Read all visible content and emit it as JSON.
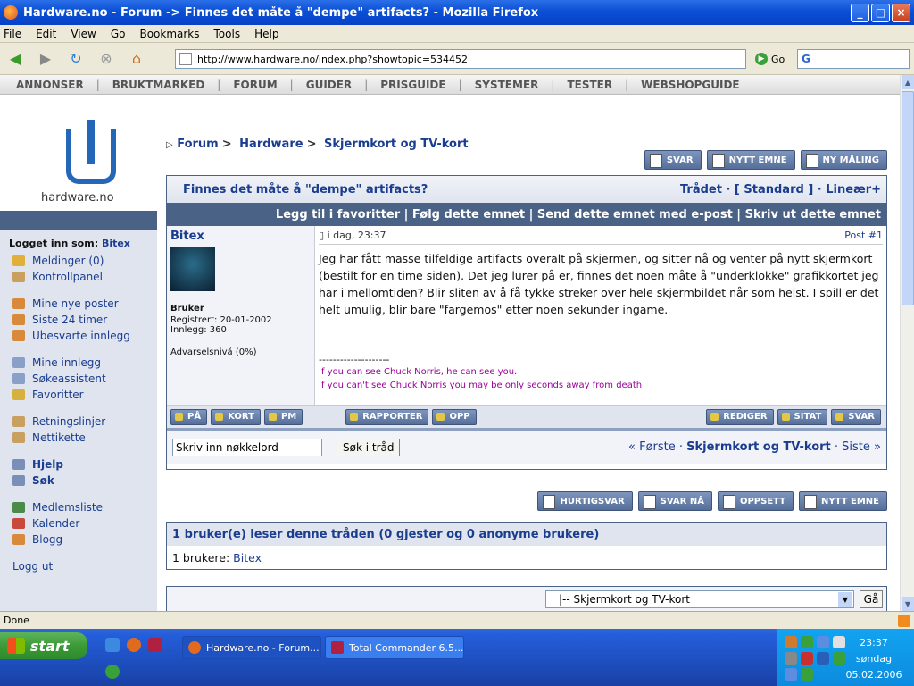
{
  "window": {
    "title": "Hardware.no - Forum -> Finnes det måte å \"dempe\" artifacts? - Mozilla Firefox"
  },
  "menu": [
    "File",
    "Edit",
    "View",
    "Go",
    "Bookmarks",
    "Tools",
    "Help"
  ],
  "navbar": {
    "url": "http://www.hardware.no/index.php?showtopic=534452",
    "go_label": "Go",
    "search_engine": "G"
  },
  "topnav": [
    "ANNONSER",
    "BRUKTMARKED",
    "FORUM",
    "GUIDER",
    "PRISGUIDE",
    "SYSTEMER",
    "TESTER",
    "WEBSHOPGUIDE"
  ],
  "logo": {
    "text": "hardware.no"
  },
  "sidebar": {
    "login_prefix": "Logget inn som:",
    "login_user": "Bitex",
    "group1": [
      "Meldinger (0)",
      "Kontrollpanel"
    ],
    "group2": [
      "Mine nye poster",
      "Siste 24 timer",
      "Ubesvarte innlegg"
    ],
    "group3": [
      "Mine innlegg",
      "Søkeassistent",
      "Favoritter"
    ],
    "group4": [
      "Retningslinjer",
      "Nettikette"
    ],
    "group5": [
      "Hjelp",
      "Søk"
    ],
    "group6": [
      "Medlemsliste",
      "Kalender",
      "Blogg"
    ],
    "logout": "Logg ut"
  },
  "breadcrumb": {
    "root": "Forum",
    "level1": "Hardware",
    "level2": "Skjermkort og TV-kort"
  },
  "topbuttons": [
    "SVAR",
    "NYTT EMNE",
    "NY MÅLING"
  ],
  "thread": {
    "title": "Finnes det måte å \"dempe\" artifacts?",
    "view_modes": "Trådet · [ Standard ] · Lineær+",
    "links": "Legg til i favoritter | Følg dette emnet | Send dette emnet med e-post | Skriv ut dette emnet"
  },
  "post": {
    "username": "Bitex",
    "role": "Bruker",
    "registered": "Registrert: 20-01-2002",
    "posts": "Innlegg: 360",
    "warning": "Advarselsnivå (0%)",
    "date": "i dag, 23:37",
    "number": "Post #1",
    "body": "Jeg har fått masse tilfeldige artifacts overalt på skjermen, og sitter nå og venter på nytt skjermkort (bestilt for en time siden). Det jeg lurer på er, finnes det noen måte å \"underklokke\" grafikkortet jeg har i mellomtiden? Blir sliten av å få tykke streker over hele skjermbildet når som helst. I spill er det helt umulig, blir bare \"fargemos\" etter noen sekunder ingame.",
    "sig_divider": "--------------------",
    "sig_line1": "If you can see Chuck Norris, he can see you.",
    "sig_line2": "If you can't see Chuck Norris you may be only seconds away from death",
    "left_buttons": [
      "PÅ",
      "KORT",
      "PM"
    ],
    "mid_buttons": [
      "RAPPORTER",
      "OPP"
    ],
    "right_buttons": [
      "REDIGER",
      "SITAT",
      "SVAR"
    ]
  },
  "thread_search": {
    "placeholder": "Skriv inn nøkkelord",
    "button": "Søk i tråd"
  },
  "pagenav": {
    "first": "« Første",
    "middle": "Skjermkort og TV-kort",
    "last": "Siste »"
  },
  "bottombuttons": [
    "HURTIGSVAR",
    "SVAR NÅ",
    "OPPSETT",
    "NYTT EMNE"
  ],
  "readers": {
    "title": "1 bruker(e) leser denne tråden (0 gjester og 0 anonyme brukere)",
    "line_prefix": "1 brukere:",
    "line_user": "Bitex"
  },
  "jump": {
    "selected": "|-- Skjermkort og TV-kort",
    "go": "Gå"
  },
  "statusbar": {
    "text": "Done"
  },
  "taskbar": {
    "start": "start",
    "tasks": [
      "Hardware.no - Forum...",
      "Total Commander 6.5..."
    ],
    "time": "23:37",
    "day": "søndag",
    "date": "05.02.2006"
  }
}
